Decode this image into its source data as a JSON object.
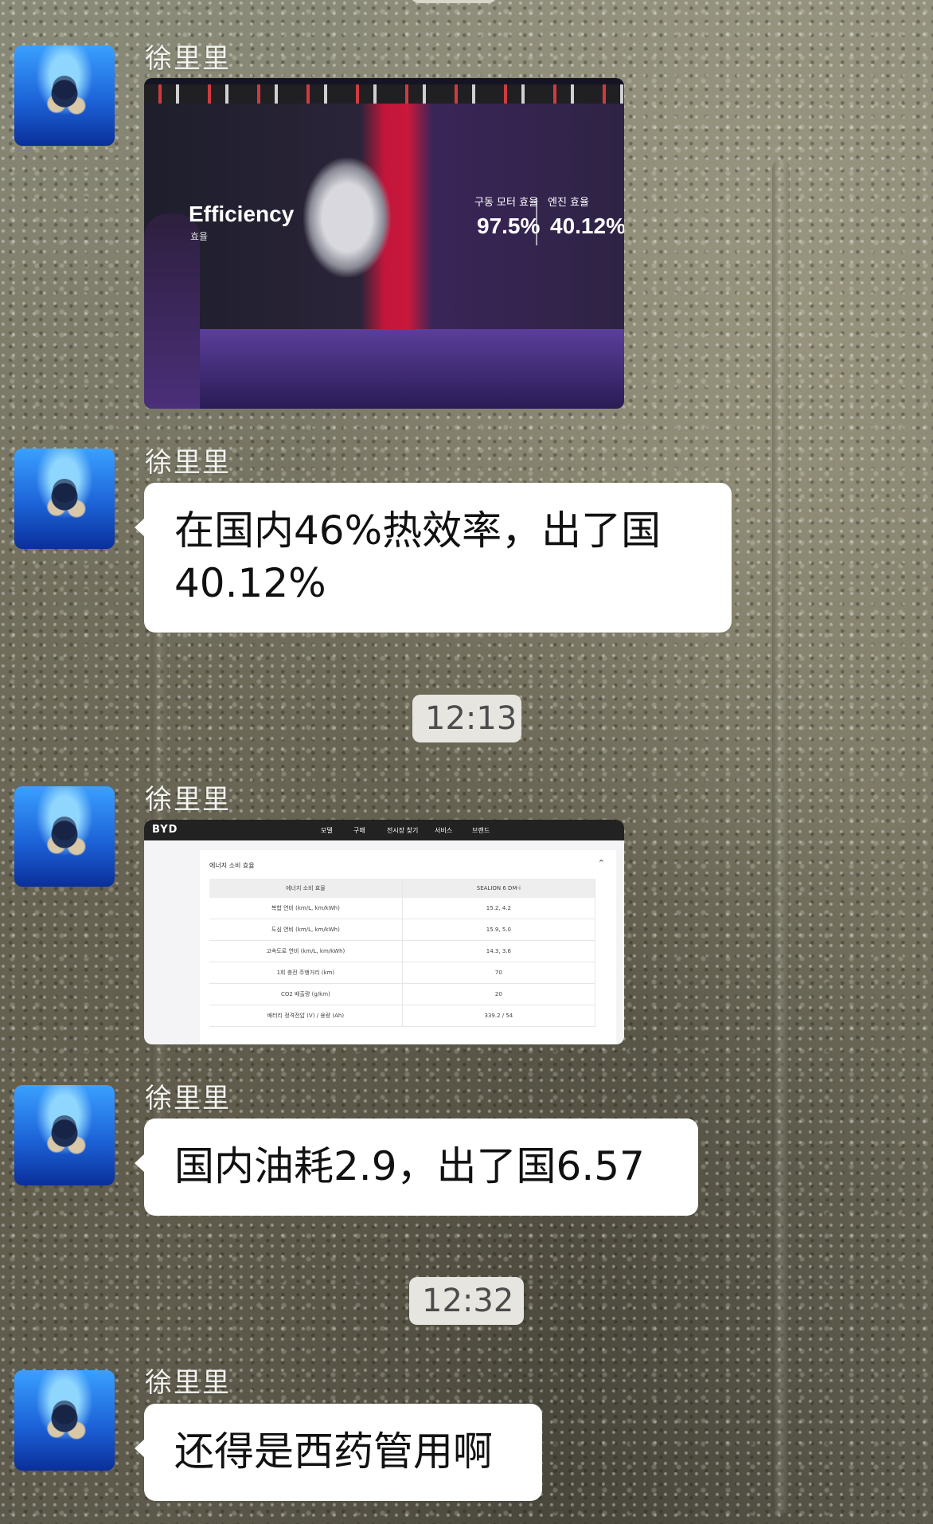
{
  "messages": [
    {
      "sender": "徐里里",
      "type": "image",
      "image": {
        "headline": "Efficiency",
        "headline_sub": "효율",
        "kpis": [
          {
            "label": "구동 모터 효율",
            "value": "97.5%"
          },
          {
            "label": "엔진 효율",
            "value": "40.12%"
          }
        ]
      }
    },
    {
      "sender": "徐里里",
      "type": "text",
      "text_line1": "在国内46%热效率，出了国",
      "text_line2": "40.12%"
    },
    {
      "sender": "徐里里",
      "type": "image",
      "image": {
        "logo": "BYD",
        "nav": [
          "모델",
          "구매",
          "전시장 찾기",
          "서비스",
          "브랜드"
        ],
        "section_title": "에너지 소비 효율",
        "table_headers": [
          "에너지 소비 효율",
          "SEALION 6 DM-i"
        ],
        "table_rows": [
          [
            "복합 연비 (km/L, km/kWh)",
            "15.2, 4.2"
          ],
          [
            "도심 연비 (km/L, km/kWh)",
            "15.9, 5.0"
          ],
          [
            "고속도로 연비 (km/L, km/kWh)",
            "14.3, 3.6"
          ],
          [
            "1회 충전 주행거리 (km)",
            "70"
          ],
          [
            "CO2 배출량 (g/km)",
            "20"
          ],
          [
            "배터리 정격전압 (V) / 용량 (Ah)",
            "339.2 / 54"
          ]
        ]
      }
    },
    {
      "sender": "徐里里",
      "type": "text",
      "text": "国内油耗2.9，出了国6.57"
    },
    {
      "sender": "徐里里",
      "type": "text",
      "text": "还得是西药管用啊"
    }
  ],
  "timestamps": [
    "12:13",
    "12:32"
  ]
}
